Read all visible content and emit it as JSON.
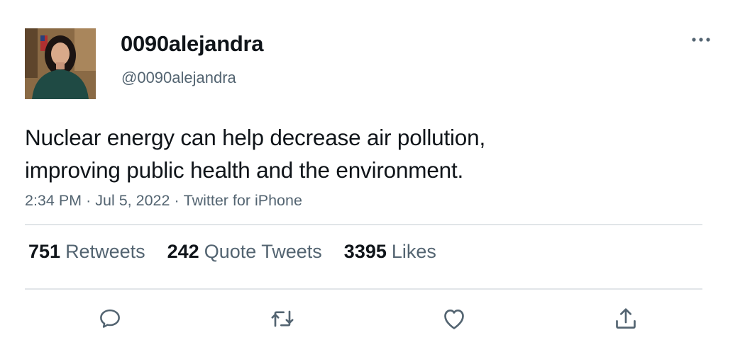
{
  "user": {
    "display_name": "0090alejandra",
    "handle": "@0090alejandra",
    "avatar_icon": "profile-photo"
  },
  "tweet": {
    "text_line1": "Nuclear energy can help decrease air pollution,",
    "text_line2": "improving public health and the environment.",
    "time": "2:34 PM",
    "date": "Jul 5, 2022",
    "source": "Twitter for iPhone",
    "separator": "·"
  },
  "stats": {
    "retweets_count": "751",
    "retweets_label": "Retweets",
    "quotes_count": "242",
    "quotes_label": "Quote Tweets",
    "likes_count": "3395",
    "likes_label": "Likes"
  },
  "actions": [
    {
      "name": "reply",
      "icon": "reply-icon"
    },
    {
      "name": "retweet",
      "icon": "retweet-icon"
    },
    {
      "name": "like",
      "icon": "heart-icon"
    },
    {
      "name": "share",
      "icon": "share-icon"
    }
  ],
  "colors": {
    "text_primary": "#0f1419",
    "text_secondary": "#536471",
    "divider": "#e1e5e8",
    "icon": "#536471"
  }
}
